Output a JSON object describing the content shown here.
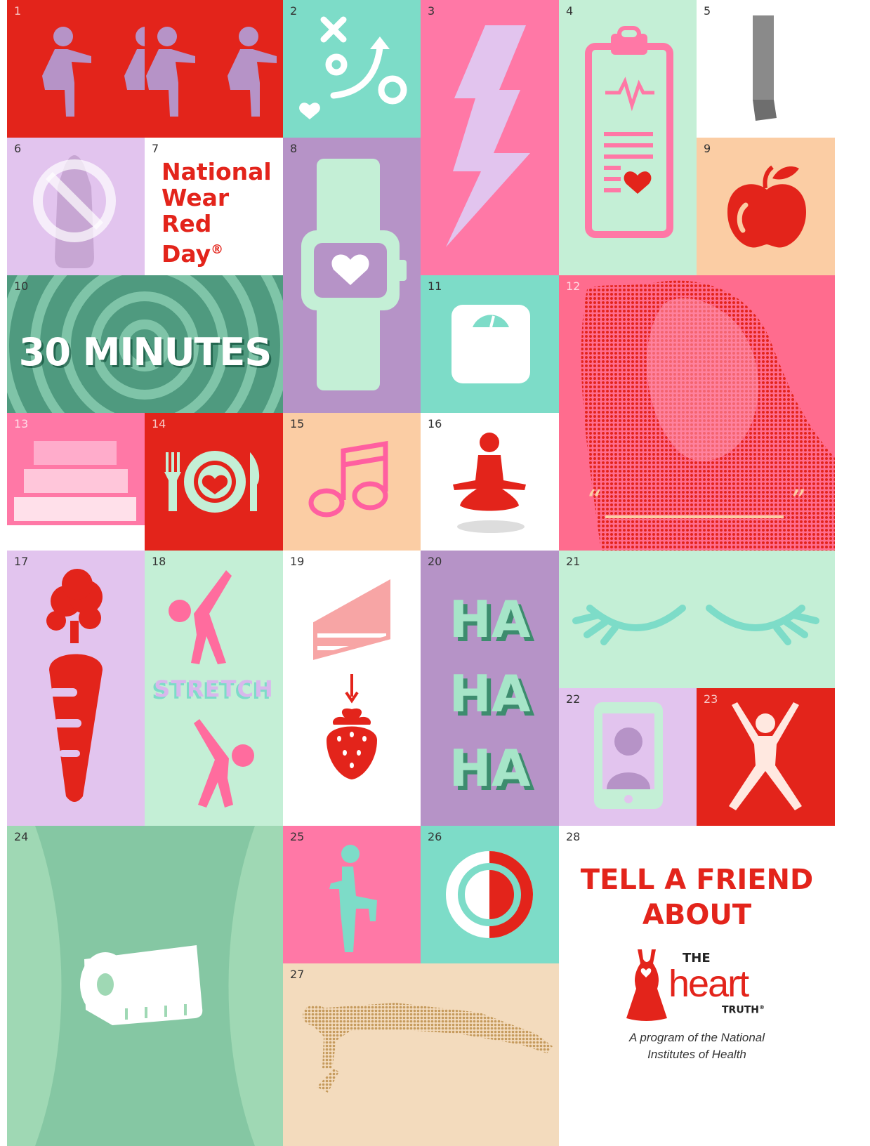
{
  "tiles": {
    "t1": "1",
    "t2": "2",
    "t3": "3",
    "t4": "4",
    "t5": "5",
    "t6": "6",
    "t7": "7",
    "t8": "8",
    "t9": "9",
    "t10": "10",
    "t11": "11",
    "t12": "12",
    "t13": "13",
    "t14": "14",
    "t15": "15",
    "t16": "16",
    "t17": "17",
    "t18": "18",
    "t19": "19",
    "t20": "20",
    "t21": "21",
    "t22": "22",
    "t23": "23",
    "t24": "24",
    "t25": "25",
    "t26": "26",
    "t27": "27",
    "t28": "28"
  },
  "wear_red": {
    "line1": "National",
    "line2": "Wear",
    "line3": "Red",
    "line4": "Day",
    "mark": "®"
  },
  "thirty": "30 MINUTES",
  "stretch": "STRETCH",
  "laugh": [
    "HA",
    "HA",
    "HA"
  ],
  "quote_marks": {
    "open": "“",
    "close": "”"
  },
  "tell_friend": {
    "line1": "TELL A FRIEND",
    "line2": "ABOUT"
  },
  "logo": {
    "the": "THE",
    "heart": "heart",
    "truth": "TRUTH",
    "mark": "®"
  },
  "program": {
    "line1": "A program of the National",
    "line2": "Institutes of Health"
  },
  "icons": [
    "squat-figure-icon",
    "game-plan-icon",
    "lightning-bolt-icon",
    "clipboard-heart-icon",
    "cigarette-icon",
    "no-salt-icon",
    "smartwatch-heart-icon",
    "apple-icon",
    "scale-icon",
    "stairs-icon",
    "plate-heart-icon",
    "music-note-icon",
    "meditation-icon",
    "carrot-icon",
    "stretch-figure-icon",
    "cake-icon",
    "strawberry-icon",
    "closed-eyes-icon",
    "phone-contact-icon",
    "jumping-jack-icon",
    "tape-measure-icon",
    "marching-figure-icon",
    "timer-icon",
    "pushup-figure-icon",
    "red-dress-icon"
  ],
  "colors": {
    "red": "#e3241b",
    "mint": "#c4efd6",
    "teal": "#7ddcc8",
    "pink": "#ff78a6",
    "lavender": "#e2c4ee",
    "purple": "#b693c7",
    "peach": "#fbcda4",
    "sand": "#f3dbbd",
    "green": "#9fd8b4",
    "white": "#ffffff"
  }
}
